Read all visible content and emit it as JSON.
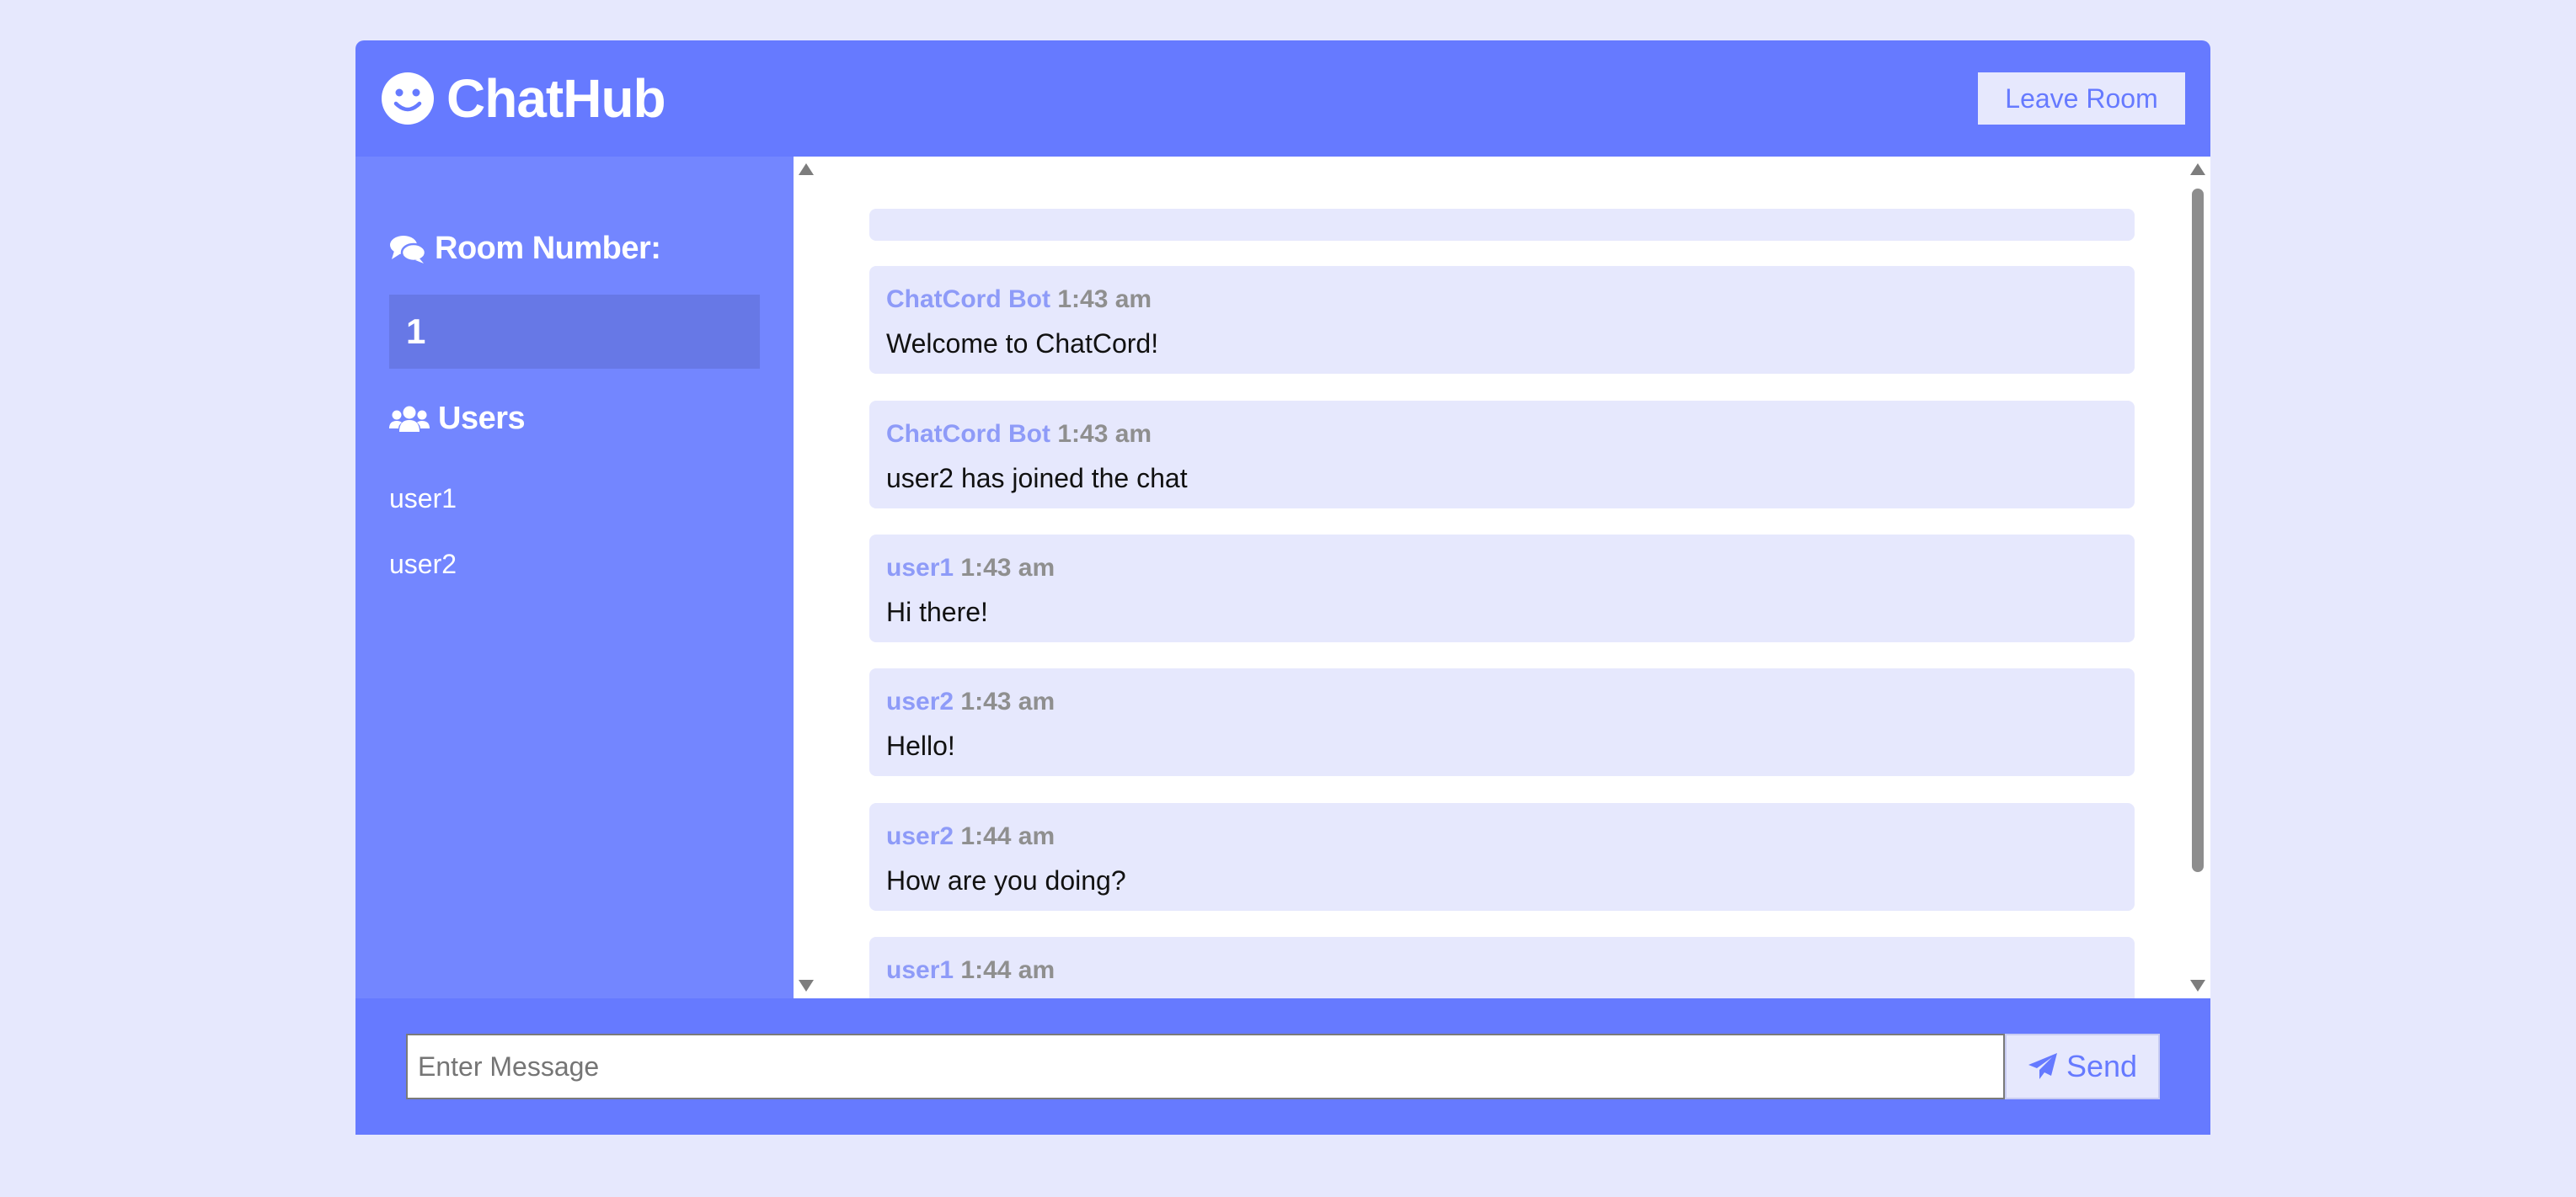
{
  "header": {
    "app_name": "ChatHub",
    "leave_label": "Leave Room"
  },
  "sidebar": {
    "room_heading": "Room Number:",
    "room_number": "1",
    "users_heading": "Users",
    "users": [
      "user1",
      "user2"
    ]
  },
  "messages": [
    {
      "user": "ChatCord Bot",
      "time": "1:43 am",
      "text": "Welcome to ChatCord!"
    },
    {
      "user": "ChatCord Bot",
      "time": "1:43 am",
      "text": "user2 has joined the chat"
    },
    {
      "user": "user1",
      "time": "1:43 am",
      "text": "Hi there!"
    },
    {
      "user": "user2",
      "time": "1:43 am",
      "text": "Hello!"
    },
    {
      "user": "user2",
      "time": "1:44 am",
      "text": "How are you doing?"
    },
    {
      "user": "user1",
      "time": "1:44 am",
      "text": ""
    }
  ],
  "composer": {
    "placeholder": "Enter Message",
    "value": "",
    "send_label": "Send"
  },
  "icons": {
    "logo": "smile-icon",
    "room": "comments-icon",
    "users": "users-icon",
    "send": "paper-plane-icon"
  },
  "colors": {
    "background": "#e6e8fd",
    "primary": "#667aff",
    "sidebar": "#7386ff",
    "room_box": "#6778e6",
    "message_bg": "#e6e8fd",
    "username": "#8e9bf8",
    "timestamp": "#8f8f8f"
  }
}
